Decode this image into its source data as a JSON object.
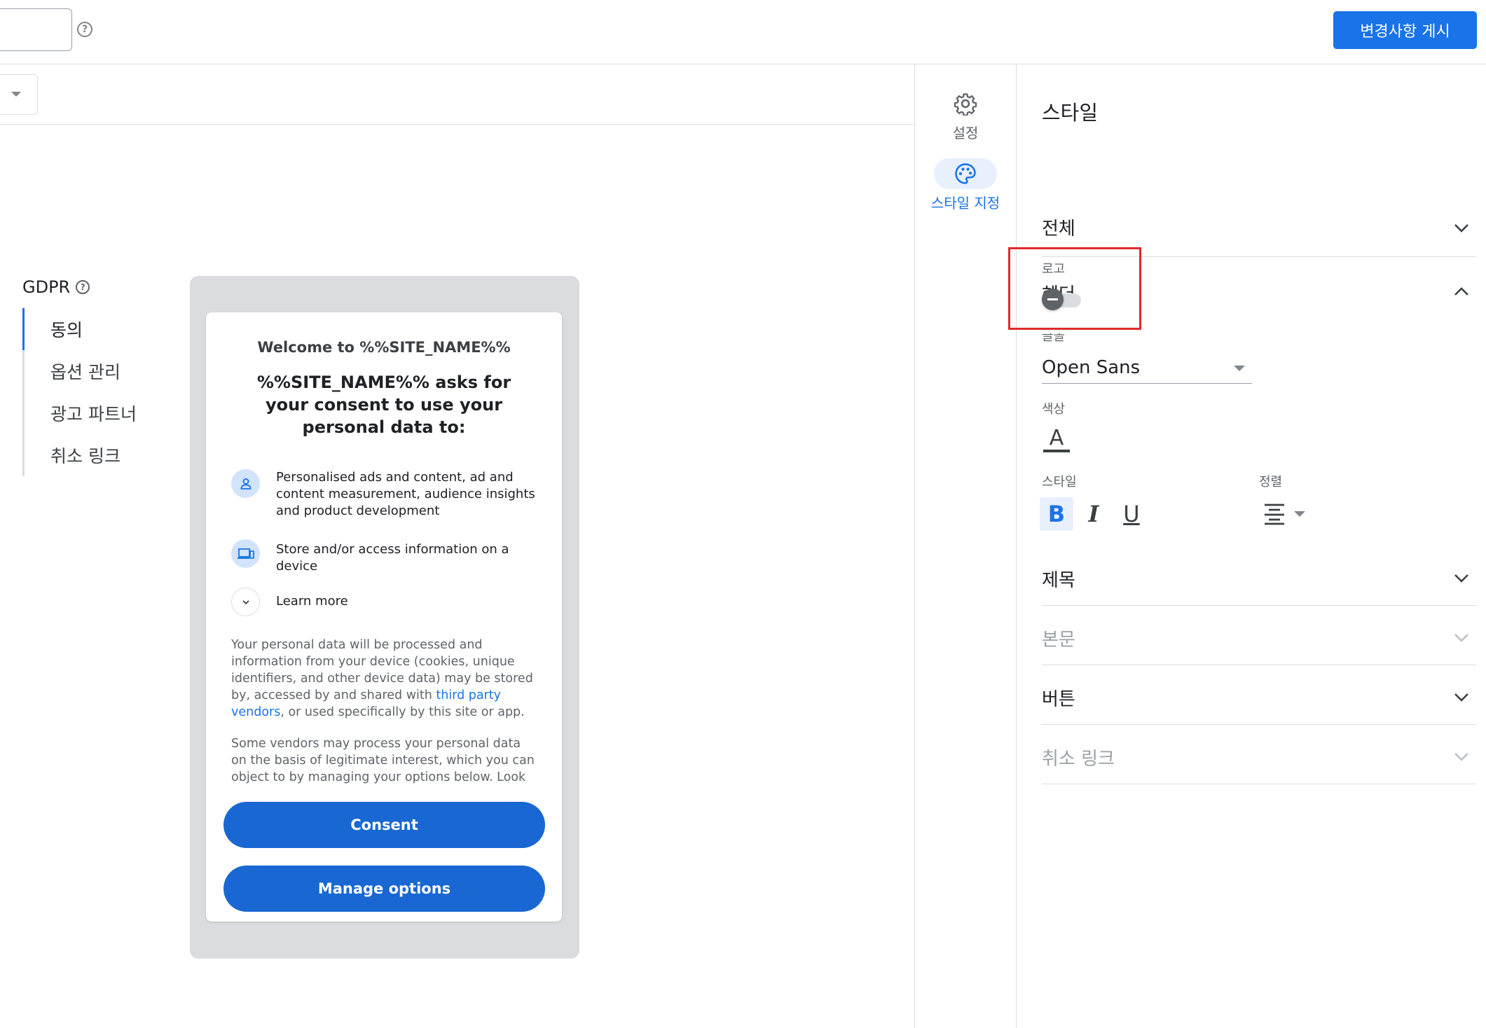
{
  "topbar": {
    "help": "?",
    "publish_label": "변경사항 게시"
  },
  "leftnav": {
    "section": "GDPR",
    "help": "?",
    "items": [
      {
        "label": "동의",
        "active": true
      },
      {
        "label": "옵션 관리",
        "active": false
      },
      {
        "label": "광고 파트너",
        "active": false
      },
      {
        "label": "취소 링크",
        "active": false
      }
    ]
  },
  "dialog": {
    "welcome": "Welcome to %%SITE_NAME%%",
    "title": "%%SITE_NAME%% asks for your consent to use your personal data to:",
    "purposes": [
      {
        "icon": "person-icon",
        "text": "Personalised ads and content, ad and content measurement, audience insights and product development"
      },
      {
        "icon": "devices-icon",
        "text": "Store and/or access information on a device"
      },
      {
        "icon": "chevron-down-icon",
        "text": "Learn more"
      }
    ],
    "para1_a": "Your personal data will be processed and information from your device (cookies, unique identifiers, and other device data) may be stored by, accessed by and shared with ",
    "para1_link": "third party vendors",
    "para1_b": ", or used specifically by this site or app.",
    "para2": "Some vendors may process your personal data on the basis of legitimate interest, which you can object to by managing your options below. Look for",
    "consent_label": "Consent",
    "manage_label": "Manage options"
  },
  "rail": {
    "tabs": [
      {
        "icon": "gear-icon",
        "label": "설정",
        "active": false
      },
      {
        "icon": "palette-icon",
        "label": "스타일 지정",
        "active": true
      }
    ]
  },
  "panel": {
    "title": "스타일",
    "sections": {
      "overall": "전체",
      "header": "헤더",
      "heading": "제목",
      "body": "본문",
      "buttons": "버튼",
      "cancel_link": "취소 링크"
    },
    "header": {
      "logo_label": "로고",
      "logo_enabled": false,
      "font_label": "글꼴",
      "font_value": "Open Sans",
      "color_label": "색상",
      "color_glyph": "A",
      "style_label": "스타일",
      "bold": "B",
      "italic": "I",
      "underline": "U",
      "align_label": "정렬"
    }
  },
  "colors": {
    "accent": "#1a73e8",
    "highlight": "#e02a2a"
  }
}
